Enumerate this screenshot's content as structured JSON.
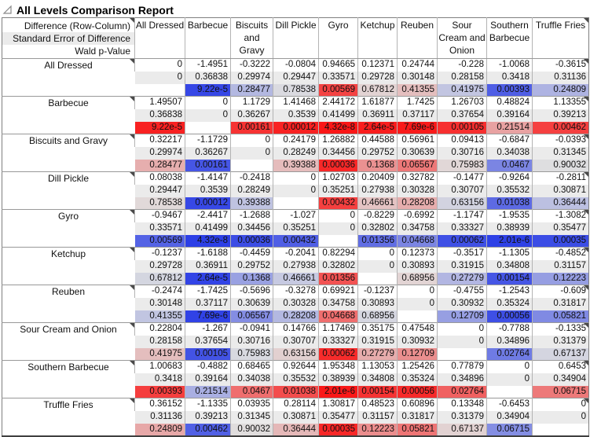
{
  "window": {
    "title": "All Levels Comparison Report"
  },
  "table": {
    "row_header_lines": [
      "Difference (Row-Column)",
      "Standard Error of Difference",
      "Wald p-Value"
    ],
    "levels": [
      "All Dressed",
      "Barbecue",
      "Biscuits and Gravy",
      "Dill Pickle",
      "Gyro",
      "Ketchup",
      "Reuben",
      "Sour Cream and Onion",
      "Southern Barbecue",
      "Truffle Fries"
    ],
    "groups": [
      {
        "diff": [
          "0",
          "-1.4951",
          "-0.3222",
          "-0.0804",
          "0.94665",
          "0.12371",
          "0.24744",
          "-0.228",
          "-1.0068",
          "-0.3615"
        ],
        "se": [
          "0",
          "0.36838",
          "0.29974",
          "0.29447",
          "0.33571",
          "0.29728",
          "0.30148",
          "0.28158",
          "0.3418",
          "0.31136"
        ],
        "p": [
          "",
          "9.22e-5",
          "0.28477",
          "0.78538",
          "0.00569",
          "0.67812",
          "0.41355",
          "0.41975",
          "0.00393",
          "0.24809"
        ]
      },
      {
        "diff": [
          "1.49507",
          "0",
          "1.1729",
          "1.41468",
          "2.44172",
          "1.61877",
          "1.7425",
          "1.26703",
          "0.48824",
          "1.13355"
        ],
        "se": [
          "0.36838",
          "0",
          "0.36267",
          "0.3539",
          "0.41499",
          "0.36911",
          "0.37117",
          "0.37654",
          "0.39164",
          "0.39213"
        ],
        "p": [
          "9.22e-5",
          "",
          "0.00161",
          "0.00012",
          "4.32e-8",
          "2.64e-5",
          "7.69e-6",
          "0.00105",
          "0.21514",
          "0.00462"
        ]
      },
      {
        "diff": [
          "0.32217",
          "-1.1729",
          "0",
          "0.24179",
          "1.26882",
          "0.44588",
          "0.56961",
          "0.09413",
          "-0.6847",
          "-0.0393"
        ],
        "se": [
          "0.29974",
          "0.36267",
          "0",
          "0.28249",
          "0.34456",
          "0.29752",
          "0.30639",
          "0.30716",
          "0.34038",
          "0.31345"
        ],
        "p": [
          "0.28477",
          "0.00161",
          "",
          "0.39388",
          "0.00036",
          "0.1368",
          "0.06567",
          "0.75983",
          "0.0467",
          "0.90032"
        ]
      },
      {
        "diff": [
          "0.08038",
          "-1.4147",
          "-0.2418",
          "0",
          "1.02703",
          "0.20409",
          "0.32782",
          "-0.1477",
          "-0.9264",
          "-0.2811"
        ],
        "se": [
          "0.29447",
          "0.3539",
          "0.28249",
          "0",
          "0.35251",
          "0.27938",
          "0.30328",
          "0.30707",
          "0.35532",
          "0.30871"
        ],
        "p": [
          "0.78538",
          "0.00012",
          "0.39388",
          "",
          "0.00432",
          "0.46661",
          "0.28208",
          "0.63156",
          "0.01038",
          "0.36444"
        ]
      },
      {
        "diff": [
          "-0.9467",
          "-2.4417",
          "-1.2688",
          "-1.027",
          "0",
          "-0.8229",
          "-0.6992",
          "-1.1747",
          "-1.9535",
          "-1.3082"
        ],
        "se": [
          "0.33571",
          "0.41499",
          "0.34456",
          "0.35251",
          "0",
          "0.32802",
          "0.34758",
          "0.33327",
          "0.38939",
          "0.35477"
        ],
        "p": [
          "0.00569",
          "4.32e-8",
          "0.00036",
          "0.00432",
          "",
          "0.01356",
          "0.04668",
          "0.00062",
          "2.01e-6",
          "0.00035"
        ]
      },
      {
        "diff": [
          "-0.1237",
          "-1.6188",
          "-0.4459",
          "-0.2041",
          "0.82294",
          "0",
          "0.12373",
          "-0.3517",
          "-1.1305",
          "-0.4852"
        ],
        "se": [
          "0.29728",
          "0.36911",
          "0.29752",
          "0.27938",
          "0.32802",
          "0",
          "0.30893",
          "0.31915",
          "0.34808",
          "0.31157"
        ],
        "p": [
          "0.67812",
          "2.64e-5",
          "0.1368",
          "0.46661",
          "0.01356",
          "",
          "0.68956",
          "0.27279",
          "0.00154",
          "0.12223"
        ]
      },
      {
        "diff": [
          "-0.2474",
          "-1.7425",
          "-0.5696",
          "-0.3278",
          "0.69921",
          "-0.1237",
          "0",
          "-0.4755",
          "-1.2543",
          "-0.609"
        ],
        "se": [
          "0.30148",
          "0.37117",
          "0.30639",
          "0.30328",
          "0.34758",
          "0.30893",
          "0",
          "0.30932",
          "0.35324",
          "0.31817"
        ],
        "p": [
          "0.41355",
          "7.69e-6",
          "0.06567",
          "0.28208",
          "0.04668",
          "0.68956",
          "",
          "0.12709",
          "0.00056",
          "0.05821"
        ]
      },
      {
        "diff": [
          "0.22804",
          "-1.267",
          "-0.0941",
          "0.14766",
          "1.17469",
          "0.35175",
          "0.47548",
          "0",
          "-0.7788",
          "-0.1335"
        ],
        "se": [
          "0.28158",
          "0.37654",
          "0.30716",
          "0.30707",
          "0.33327",
          "0.31915",
          "0.30932",
          "0",
          "0.34896",
          "0.31379"
        ],
        "p": [
          "0.41975",
          "0.00105",
          "0.75983",
          "0.63156",
          "0.00062",
          "0.27279",
          "0.12709",
          "",
          "0.02764",
          "0.67137"
        ]
      },
      {
        "diff": [
          "1.00683",
          "-0.4882",
          "0.68465",
          "0.92644",
          "1.95348",
          "1.13053",
          "1.25426",
          "0.77879",
          "0",
          "0.6453"
        ],
        "se": [
          "0.3418",
          "0.39164",
          "0.34038",
          "0.35532",
          "0.38939",
          "0.34808",
          "0.35324",
          "0.34896",
          "0",
          "0.34904"
        ],
        "p": [
          "0.00393",
          "0.21514",
          "0.0467",
          "0.01038",
          "2.01e-6",
          "0.00154",
          "0.00056",
          "0.02764",
          "",
          "0.06715"
        ]
      },
      {
        "diff": [
          "0.36152",
          "-1.1335",
          "0.03935",
          "0.28114",
          "1.30817",
          "0.48523",
          "0.60896",
          "0.13348",
          "-0.6453",
          "0"
        ],
        "se": [
          "0.31136",
          "0.39213",
          "0.31345",
          "0.30871",
          "0.35477",
          "0.31157",
          "0.31817",
          "0.31379",
          "0.34904",
          "0"
        ],
        "p": [
          "0.24809",
          "0.00462",
          "0.90032",
          "0.36444",
          "0.00035",
          "0.12223",
          "0.05821",
          "0.67137",
          "0.06715",
          ""
        ]
      }
    ],
    "colors": {
      "negative_full": "#2b3ee6",
      "positive_full": "#fa1515",
      "neutral_base": "#e0e0e0",
      "se_row_bg": "#ebebeb",
      "grid": "#b3b3b3",
      "group_line": "#999999"
    }
  }
}
